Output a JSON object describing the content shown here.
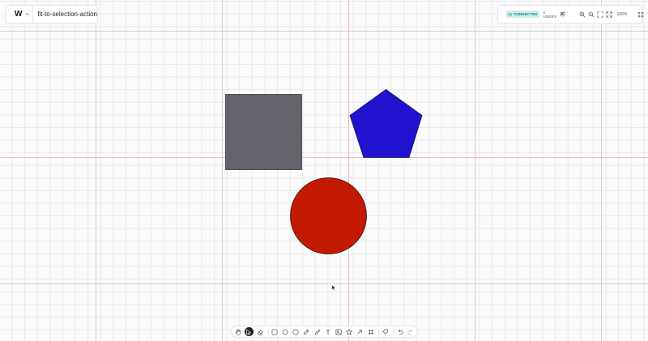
{
  "header": {
    "logo_text": "W",
    "document_title": "fit-to-selection-action"
  },
  "status": {
    "connection": "CONNECTED",
    "users": "1 USERS",
    "avatar_initials": "JC",
    "zoom": "100%"
  },
  "colors": {
    "square": "#63636b",
    "pentagon": "#2012cf",
    "circle": "#c41a02",
    "connected_badge": "#cdeff0"
  },
  "toolbar": {
    "tools": [
      "hand",
      "select",
      "eraser",
      "rectangle",
      "ellipse",
      "circle",
      "pen",
      "pencil",
      "text",
      "image",
      "star",
      "arrow",
      "frame",
      "shape-picker",
      "undo",
      "redo"
    ],
    "active": "select"
  }
}
